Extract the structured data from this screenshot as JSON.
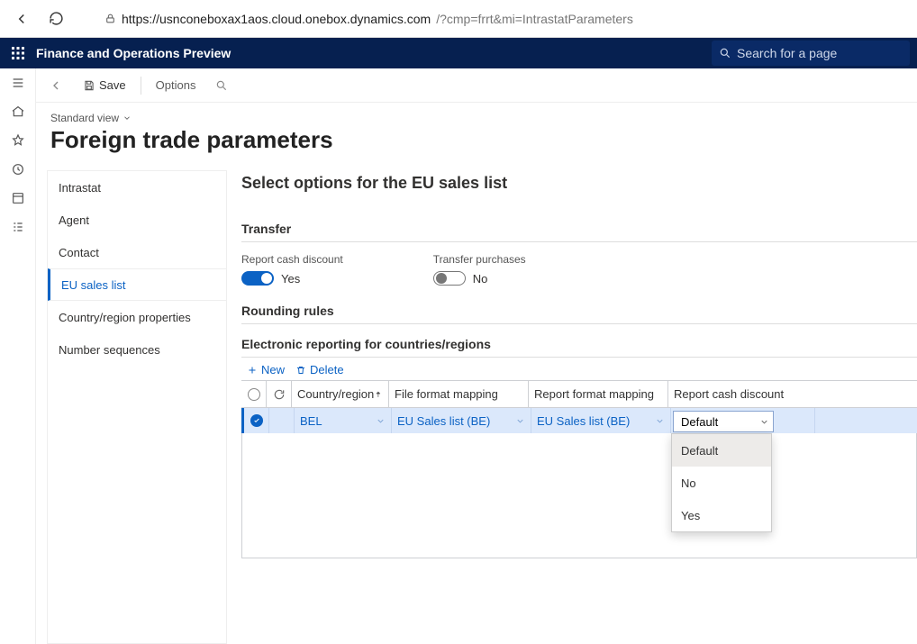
{
  "browser": {
    "url_host": "https://usnconeboxax1aos.cloud.onebox.dynamics.com",
    "url_path": "/?cmp=frrt&mi=IntrastatParameters"
  },
  "header": {
    "app_title": "Finance and Operations Preview",
    "search_placeholder": "Search for a page"
  },
  "actionbar": {
    "save": "Save",
    "options": "Options"
  },
  "page": {
    "view_label": "Standard view",
    "title": "Foreign trade parameters"
  },
  "vtabs": {
    "items": [
      {
        "label": "Intrastat"
      },
      {
        "label": "Agent"
      },
      {
        "label": "Contact"
      },
      {
        "label": "EU sales list"
      },
      {
        "label": "Country/region properties"
      },
      {
        "label": "Number sequences"
      }
    ],
    "active_index": 3
  },
  "content": {
    "heading": "Select options for the EU sales list",
    "section_transfer": "Transfer",
    "report_cash_discount_label": "Report cash discount",
    "report_cash_discount_value": "Yes",
    "transfer_purchases_label": "Transfer purchases",
    "transfer_purchases_value": "No",
    "section_rounding": "Rounding rules",
    "section_er": "Electronic reporting for countries/regions"
  },
  "grid_toolbar": {
    "new": "New",
    "delete": "Delete"
  },
  "grid": {
    "columns": {
      "country": "Country/region",
      "file_mapping": "File format mapping",
      "report_mapping": "Report format mapping",
      "discount": "Report cash discount"
    },
    "row": {
      "country": "BEL",
      "file_mapping": "EU Sales list (BE)",
      "report_mapping": "EU Sales list (BE)",
      "discount_value": "Default"
    },
    "dropdown_options": [
      "Default",
      "No",
      "Yes"
    ]
  }
}
